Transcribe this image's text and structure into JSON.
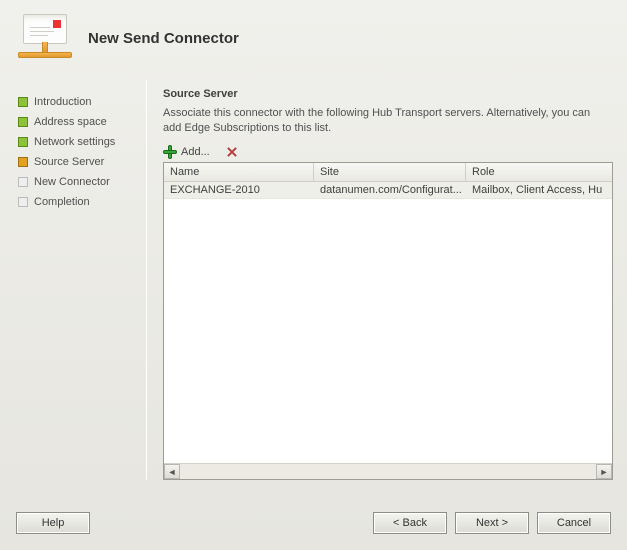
{
  "header": {
    "title": "New Send Connector"
  },
  "steps": [
    {
      "label": "Introduction",
      "state": "done"
    },
    {
      "label": "Address space",
      "state": "done"
    },
    {
      "label": "Network settings",
      "state": "done"
    },
    {
      "label": "Source Server",
      "state": "active"
    },
    {
      "label": "New Connector",
      "state": "upcoming"
    },
    {
      "label": "Completion",
      "state": "upcoming"
    }
  ],
  "content": {
    "section_title": "Source Server",
    "description": "Associate this connector with the following Hub Transport servers. Alternatively, you can add Edge Subscriptions to this list.",
    "toolbar": {
      "add_label": "Add..."
    },
    "columns": {
      "name": "Name",
      "site": "Site",
      "role": "Role"
    },
    "rows": [
      {
        "name": "EXCHANGE-2010",
        "site": "datanumen.com/Configurat...",
        "role": "Mailbox, Client Access, Hu"
      }
    ]
  },
  "footer": {
    "help": "Help",
    "back": "< Back",
    "next": "Next >",
    "cancel": "Cancel"
  }
}
